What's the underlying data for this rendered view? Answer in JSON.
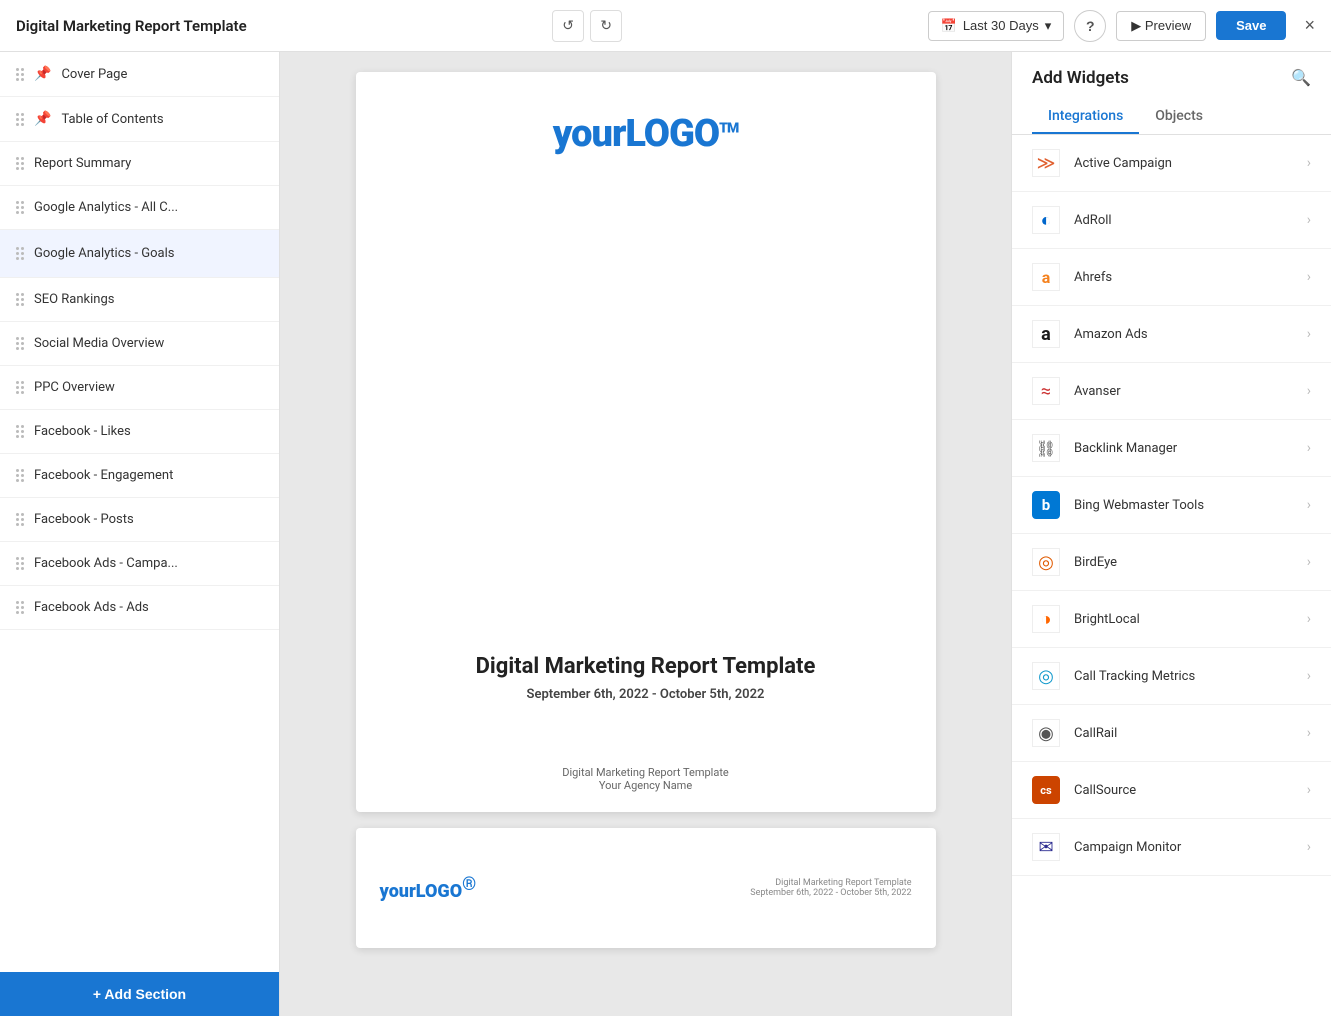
{
  "app": {
    "title": "Digital Marketing Report Template",
    "close_label": "×"
  },
  "toolbar": {
    "undo_label": "↺",
    "redo_label": "↻",
    "date_range_label": "Last 30 Days",
    "help_label": "?",
    "preview_label": "▶ Preview",
    "save_label": "Save"
  },
  "sidebar": {
    "items": [
      {
        "id": "cover-page",
        "label": "Cover Page",
        "pinned": true
      },
      {
        "id": "table-of-contents",
        "label": "Table of Contents",
        "pinned": true
      },
      {
        "id": "report-summary",
        "label": "Report Summary",
        "pinned": false
      },
      {
        "id": "google-analytics-all",
        "label": "Google Analytics - All C...",
        "pinned": false
      },
      {
        "id": "google-analytics-goals",
        "label": "Google Analytics - Goals",
        "pinned": false,
        "active": true
      },
      {
        "id": "seo-rankings",
        "label": "SEO Rankings",
        "pinned": false
      },
      {
        "id": "social-media-overview",
        "label": "Social Media Overview",
        "pinned": false
      },
      {
        "id": "ppc-overview",
        "label": "PPC Overview",
        "pinned": false
      },
      {
        "id": "facebook-likes",
        "label": "Facebook - Likes",
        "pinned": false
      },
      {
        "id": "facebook-engagement",
        "label": "Facebook - Engagement",
        "pinned": false
      },
      {
        "id": "facebook-posts",
        "label": "Facebook - Posts",
        "pinned": false
      },
      {
        "id": "facebook-ads-campa",
        "label": "Facebook Ads - Campa...",
        "pinned": false
      },
      {
        "id": "facebook-ads-ads",
        "label": "Facebook Ads - Ads",
        "pinned": false
      }
    ],
    "add_section_label": "+ Add Section"
  },
  "canvas": {
    "page_main": {
      "logo_text_light": "your",
      "logo_text_bold": "LOGO",
      "logo_tm": "TM",
      "report_title": "Digital Marketing Report Template",
      "report_date": "September 6th, 2022 - October 5th, 2022",
      "footer_title": "Digital Marketing Report Template",
      "footer_agency": "Your Agency Name"
    },
    "page_thumb": {
      "logo_text_light": "your",
      "logo_text_bold": "LOGO",
      "logo_sup": "®",
      "meta_title": "Digital Marketing Report Template",
      "meta_date": "September 6th, 2022 - October 5th, 2022"
    }
  },
  "right_panel": {
    "title": "Add Widgets",
    "tab_integrations": "Integrations",
    "tab_objects": "Objects",
    "integrations": [
      {
        "id": "active-campaign",
        "name": "Active Campaign",
        "icon_color": "#e06030",
        "icon_char": "≫"
      },
      {
        "id": "adroll",
        "name": "AdRoll",
        "icon_color": "#0077cc",
        "icon_char": "◎"
      },
      {
        "id": "ahrefs",
        "name": "Ahrefs",
        "icon_color": "#f4821f",
        "icon_char": "a"
      },
      {
        "id": "amazon-ads",
        "name": "Amazon Ads",
        "icon_color": "#1a1a1a",
        "icon_char": "a"
      },
      {
        "id": "avanser",
        "name": "Avanser",
        "icon_color": "#cc3333",
        "icon_char": "≋"
      },
      {
        "id": "backlink-manager",
        "name": "Backlink Manager",
        "icon_color": "#444",
        "icon_char": "⛓"
      },
      {
        "id": "bing-webmaster",
        "name": "Bing Webmaster Tools",
        "icon_color": "#0078d4",
        "icon_char": "b"
      },
      {
        "id": "birdeye",
        "name": "BirdEye",
        "icon_color": "#e05a00",
        "icon_char": "◉"
      },
      {
        "id": "brightlocal",
        "name": "BrightLocal",
        "icon_color": "#ff6600",
        "icon_char": "◍"
      },
      {
        "id": "call-tracking-metrics",
        "name": "Call Tracking Metrics",
        "icon_color": "#1199cc",
        "icon_char": "◎"
      },
      {
        "id": "callrail",
        "name": "CallRail",
        "icon_color": "#555",
        "icon_char": "◉"
      },
      {
        "id": "callsource",
        "name": "CallSource",
        "icon_color": "#cc4400",
        "icon_char": "cs"
      },
      {
        "id": "campaign-monitor",
        "name": "Campaign Monitor",
        "icon_color": "#2b2b90",
        "icon_char": "✉"
      }
    ]
  }
}
